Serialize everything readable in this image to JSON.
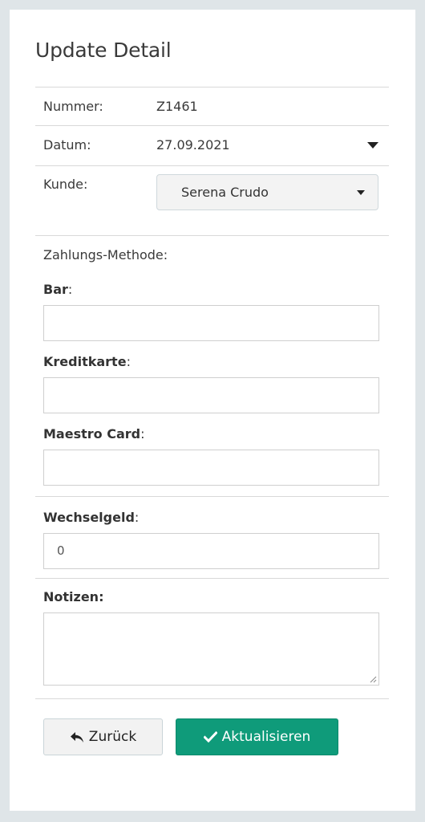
{
  "page": {
    "title": "Update Detail"
  },
  "fields": {
    "nummer_label": "Nummer:",
    "nummer_value": "Z1461",
    "datum_label": "Datum:",
    "datum_value": "27.09.2021",
    "kunde_label": "Kunde:",
    "kunde_value": "Serena Crudo"
  },
  "payment": {
    "section_label": "Zahlungs-Methode:",
    "bar_label": "Bar",
    "bar_value": "",
    "kreditkarte_label": "Kreditkarte",
    "kreditkarte_value": "",
    "maestro_label": "Maestro Card",
    "maestro_value": "",
    "colon": ":"
  },
  "wechselgeld": {
    "label": "Wechselgeld",
    "value": "0"
  },
  "notizen": {
    "label": "Notizen:",
    "value": ""
  },
  "buttons": {
    "back_label": "Zurück",
    "update_label": "Aktualisieren"
  },
  "icons": {
    "date_dropdown": "caret-down-icon",
    "customer_dropdown": "caret-down-icon",
    "back": "reply-arrow-icon",
    "update": "check-icon",
    "resize": "resize-grip-icon"
  },
  "colors": {
    "primary": "#0f9b7a",
    "background": "#dfe5e8"
  }
}
